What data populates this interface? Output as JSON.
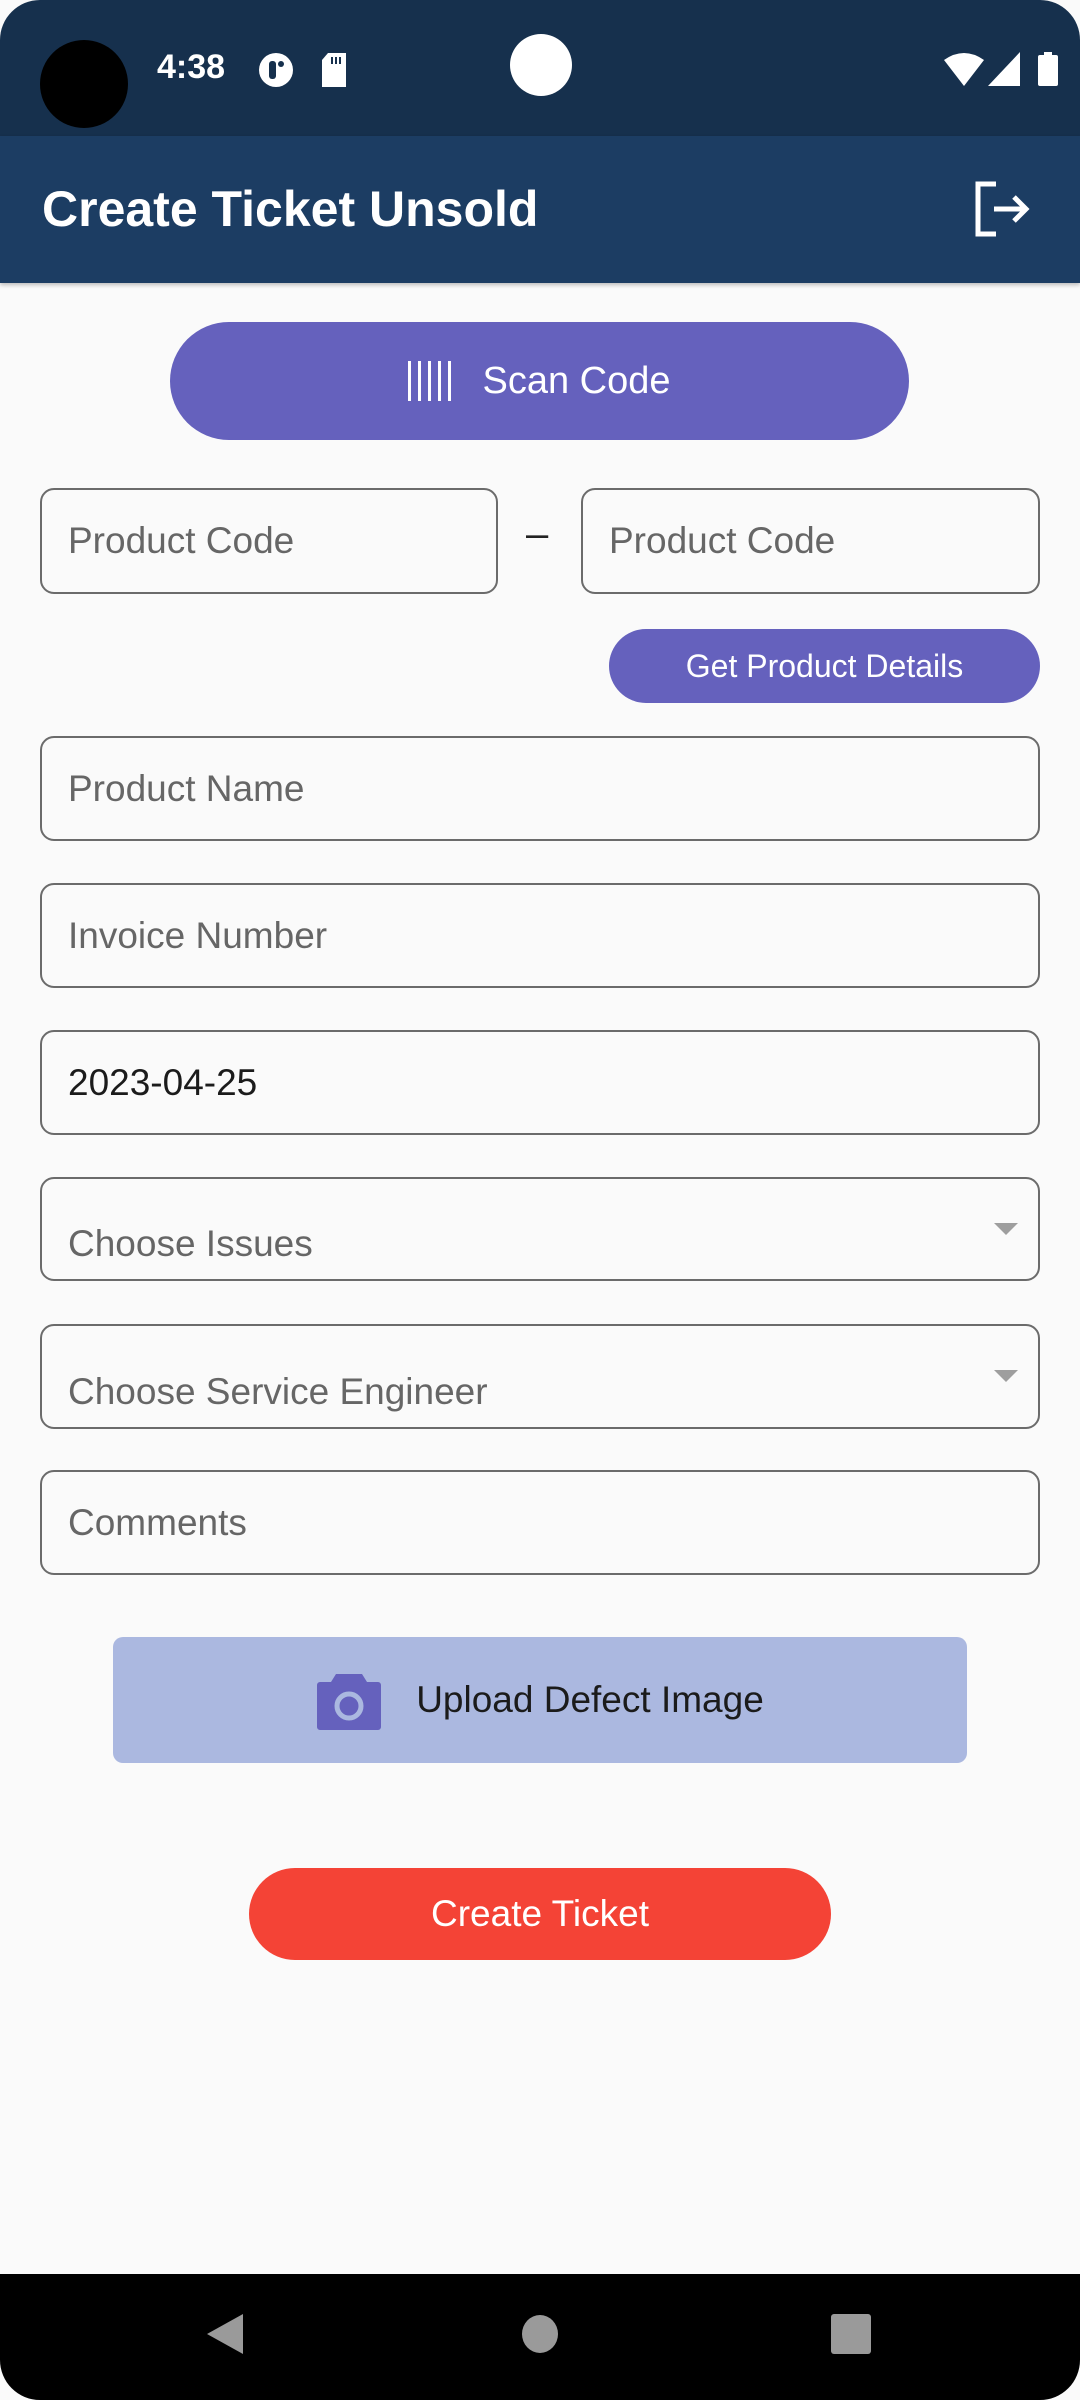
{
  "status_bar": {
    "time": "4:38",
    "icons": [
      "notification-icon",
      "sd-card-icon",
      "wifi-icon",
      "signal-icon",
      "battery-icon"
    ]
  },
  "app_bar": {
    "title": "Create Ticket Unsold",
    "action_icon": "logout-icon"
  },
  "scan": {
    "label": "Scan Code",
    "icon": "barcode-icon"
  },
  "product_code": {
    "left_placeholder": "Product Code",
    "separator": "–",
    "right_placeholder": "Product Code"
  },
  "get_details": {
    "label": "Get Product Details"
  },
  "form": {
    "product_name_placeholder": "Product Name",
    "invoice_placeholder": "Invoice Number",
    "date_value": "2023-04-25",
    "issues_placeholder": "Choose Issues",
    "engineer_placeholder": "Choose Service Engineer",
    "comments_placeholder": "Comments"
  },
  "upload": {
    "label": "Upload Defect Image",
    "icon": "camera-icon"
  },
  "create": {
    "label": "Create Ticket"
  },
  "colors": {
    "app_bar": "#1c3d63",
    "status_bar": "#16304d",
    "primary": "#6561bd",
    "upload_bg": "#abb8e0",
    "create": "#f44336"
  }
}
